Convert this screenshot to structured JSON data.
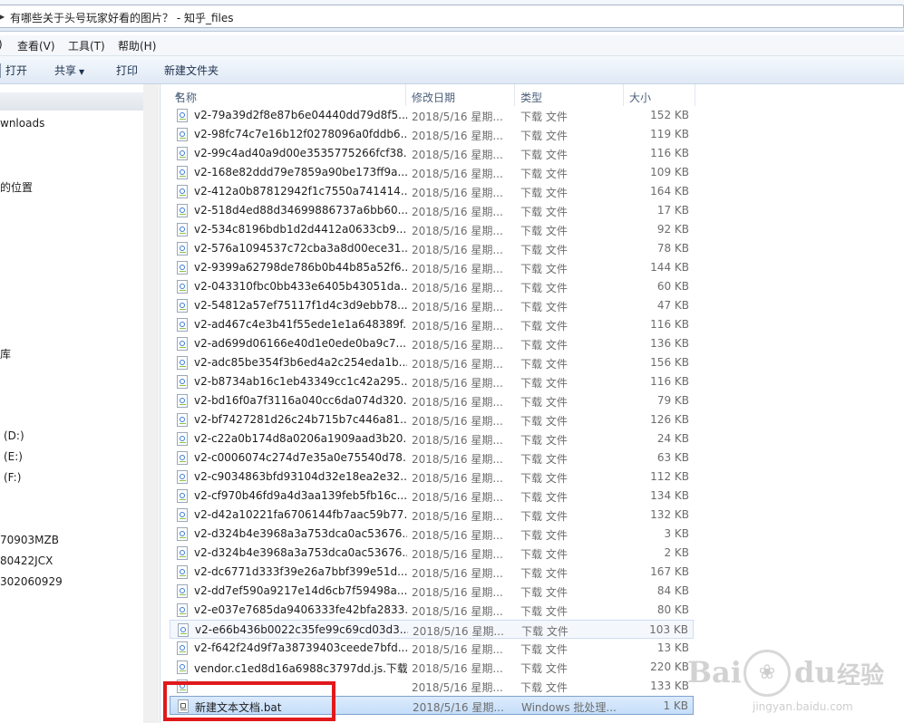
{
  "address": {
    "path": "有哪些关于头号玩家好看的图片？ - 知乎_files"
  },
  "menu": [
    "查看(V)",
    "工具(T)",
    "帮助(H)"
  ],
  "toolbar": {
    "open": "打开",
    "share": "共享",
    "print": "打印",
    "new_folder": "新建文件夹"
  },
  "nav": {
    "items": [
      "wnloads",
      "的位置",
      "库",
      "(D:)",
      "(E:)",
      "(F:)",
      "70903MZB",
      "80422JCX",
      "302060929"
    ]
  },
  "columns": {
    "name": "名称",
    "date": "修改日期",
    "type": "类型",
    "size": "大小"
  },
  "files": [
    {
      "name": "v2-79a39d2f8e87b6e04440dd79d8f5...",
      "date": "2018/5/16 星期...",
      "type": "下载 文件",
      "size": "152 KB"
    },
    {
      "name": "v2-98fc74c7e16b12f0278096a0fddb6...",
      "date": "2018/5/16 星期...",
      "type": "下载 文件",
      "size": "119 KB"
    },
    {
      "name": "v2-99c4ad40a9d00e3535775266fcf38...",
      "date": "2018/5/16 星期...",
      "type": "下载 文件",
      "size": "116 KB"
    },
    {
      "name": "v2-168e82ddd79e7859a90be173ff9a...",
      "date": "2018/5/16 星期...",
      "type": "下载 文件",
      "size": "109 KB"
    },
    {
      "name": "v2-412a0b87812942f1c7550a741414...",
      "date": "2018/5/16 星期...",
      "type": "下载 文件",
      "size": "164 KB"
    },
    {
      "name": "v2-518d4ed88d34699886737a6bb60...",
      "date": "2018/5/16 星期...",
      "type": "下载 文件",
      "size": "17 KB"
    },
    {
      "name": "v2-534c8196bdb1d2d4412a0633cb9...",
      "date": "2018/5/16 星期...",
      "type": "下载 文件",
      "size": "92 KB"
    },
    {
      "name": "v2-576a1094537c72cba3a8d00ece31...",
      "date": "2018/5/16 星期...",
      "type": "下载 文件",
      "size": "78 KB"
    },
    {
      "name": "v2-9399a62798de786b0b44b85a52f6...",
      "date": "2018/5/16 星期...",
      "type": "下载 文件",
      "size": "144 KB"
    },
    {
      "name": "v2-043310fbc0bb433e6405b43051da...",
      "date": "2018/5/16 星期...",
      "type": "下载 文件",
      "size": "60 KB"
    },
    {
      "name": "v2-54812a57ef75117f1d4c3d9ebb78...",
      "date": "2018/5/16 星期...",
      "type": "下载 文件",
      "size": "47 KB"
    },
    {
      "name": "v2-ad467c4e3b41f55ede1e1a648389f...",
      "date": "2018/5/16 星期...",
      "type": "下载 文件",
      "size": "116 KB"
    },
    {
      "name": "v2-ad699d06166e40d1e0ede0ba9c7...",
      "date": "2018/5/16 星期...",
      "type": "下载 文件",
      "size": "136 KB"
    },
    {
      "name": "v2-adc85be354f3b6ed4a2c254eda1b...",
      "date": "2018/5/16 星期...",
      "type": "下载 文件",
      "size": "156 KB"
    },
    {
      "name": "v2-b8734ab16c1eb43349cc1c42a295...",
      "date": "2018/5/16 星期...",
      "type": "下载 文件",
      "size": "116 KB"
    },
    {
      "name": "v2-bd16f0a7f3116a040cc6da074d320...",
      "date": "2018/5/16 星期...",
      "type": "下载 文件",
      "size": "79 KB"
    },
    {
      "name": "v2-bf7427281d26c24b715b7c446a81...",
      "date": "2018/5/16 星期...",
      "type": "下载 文件",
      "size": "126 KB"
    },
    {
      "name": "v2-c22a0b174d8a0206a1909aad3b20...",
      "date": "2018/5/16 星期...",
      "type": "下载 文件",
      "size": "24 KB"
    },
    {
      "name": "v2-c0006074c274d7e35a0e75540d78...",
      "date": "2018/5/16 星期...",
      "type": "下载 文件",
      "size": "63 KB"
    },
    {
      "name": "v2-c9034863bfd93104d32e18ea2e32...",
      "date": "2018/5/16 星期...",
      "type": "下载 文件",
      "size": "112 KB"
    },
    {
      "name": "v2-cf970b46fd9a4d3aa139feb5fb16c...",
      "date": "2018/5/16 星期...",
      "type": "下载 文件",
      "size": "134 KB"
    },
    {
      "name": "v2-d42a10221fa6706144fb7aac59b77...",
      "date": "2018/5/16 星期...",
      "type": "下载 文件",
      "size": "132 KB"
    },
    {
      "name": "v2-d324b4e3968a3a753dca0ac53676...",
      "date": "2018/5/16 星期...",
      "type": "下载 文件",
      "size": "3 KB"
    },
    {
      "name": "v2-d324b4e3968a3a753dca0ac53676...",
      "date": "2018/5/16 星期...",
      "type": "下载 文件",
      "size": "2 KB"
    },
    {
      "name": "v2-dc6771d333f39e26a7bbf399e51d...",
      "date": "2018/5/16 星期...",
      "type": "下载 文件",
      "size": "167 KB"
    },
    {
      "name": "v2-dd7ef590a9217e14d6cb7f59498a...",
      "date": "2018/5/16 星期...",
      "type": "下载 文件",
      "size": "84 KB"
    },
    {
      "name": "v2-e037e7685da9406333fe42bfa2833...",
      "date": "2018/5/16 星期...",
      "type": "下载 文件",
      "size": "80 KB"
    },
    {
      "name": "v2-e66b436b0022c35fe99c69cd03d3...",
      "date": "2018/5/16 星期...",
      "type": "下载 文件",
      "size": "103 KB"
    },
    {
      "name": "v2-f642f24d9f7a38739403ceede7bfd...",
      "date": "2018/5/16 星期...",
      "type": "下载 文件",
      "size": "13 KB"
    },
    {
      "name": "vendor.c1ed8d16a6988c3797dd.js.下载",
      "date": "2018/5/16 星期...",
      "type": "下载 文件",
      "size": "220 KB"
    },
    {
      "name": "",
      "date": "2018/5/16 星期...",
      "type": "下载 文件",
      "size": "133 KB"
    },
    {
      "name": "新建文本文档.bat",
      "date": "2018/5/16 星期...",
      "type": "Windows 批处理...",
      "size": "1 KB"
    }
  ],
  "watermark": {
    "brand_left": "Bai",
    "brand_right": "du",
    "brand_cn": "经验",
    "url": "jingyan.baidu.com"
  },
  "colors": {
    "highlight_box": "#e0191c",
    "selection": "#c5defa"
  }
}
